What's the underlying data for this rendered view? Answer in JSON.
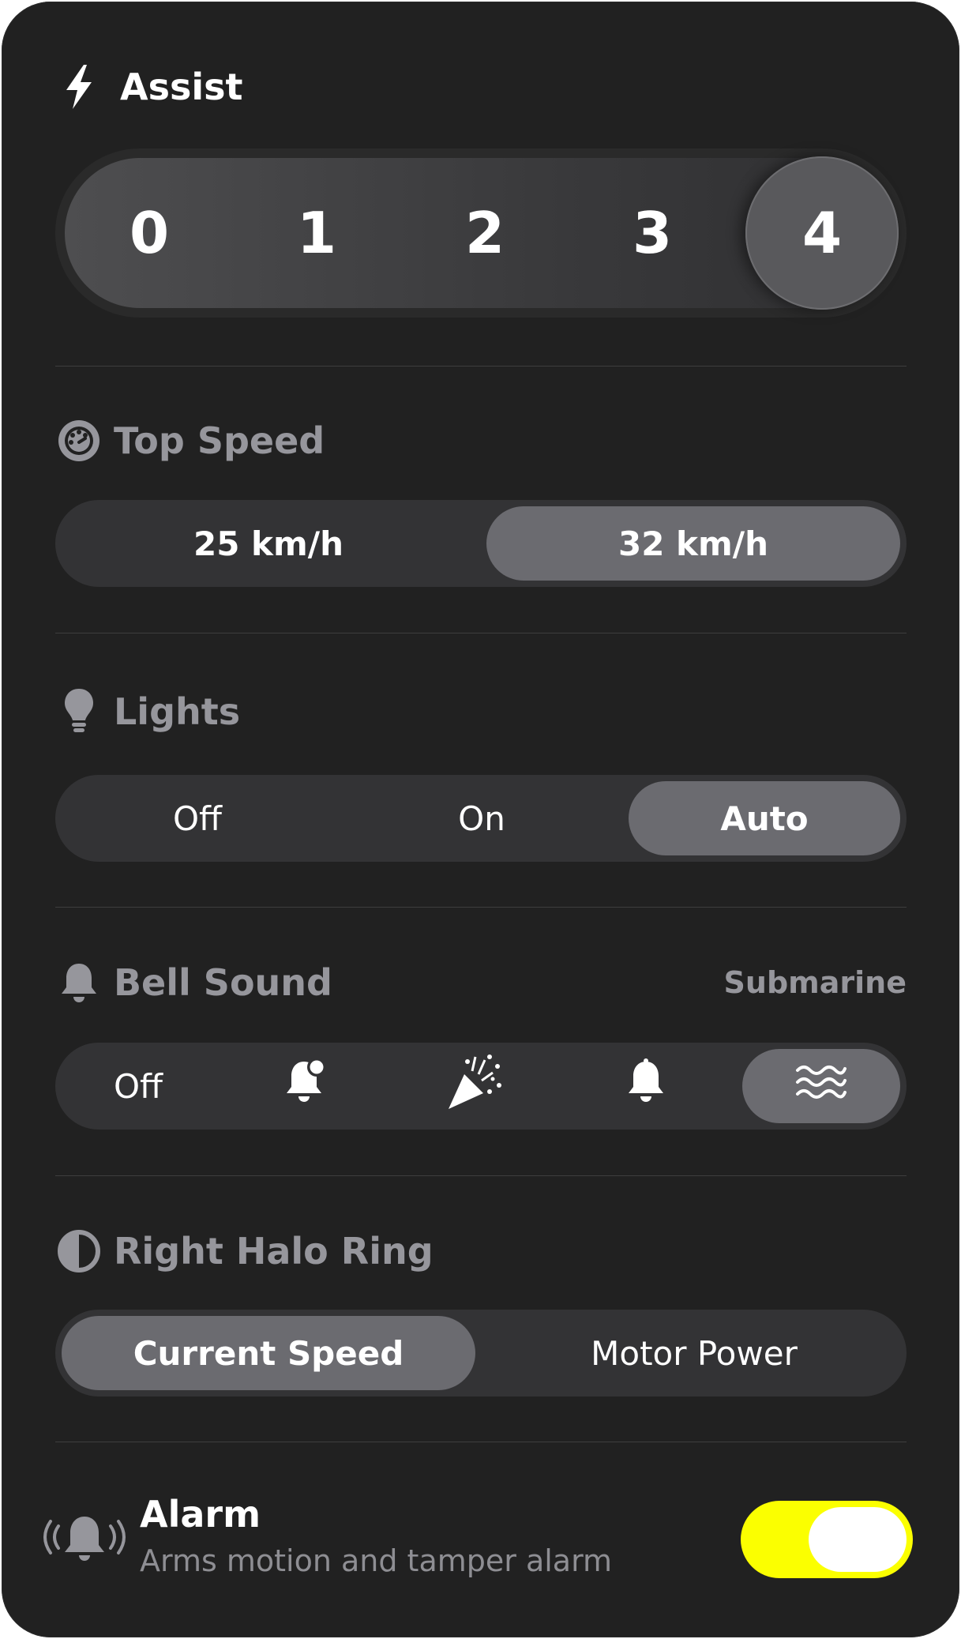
{
  "assist": {
    "title": "Assist",
    "levels": [
      "0",
      "1",
      "2",
      "3",
      "4"
    ],
    "selected": "4"
  },
  "top_speed": {
    "title": "Top Speed",
    "options": [
      "25 km/h",
      "32 km/h"
    ],
    "selected": "32 km/h"
  },
  "lights": {
    "title": "Lights",
    "options": [
      "Off",
      "On",
      "Auto"
    ],
    "selected": "Auto"
  },
  "bell_sound": {
    "title": "Bell Sound",
    "current_value": "Submarine",
    "options": [
      {
        "label": "Off",
        "icon": null
      },
      {
        "label": null,
        "icon": "bell-badge-icon"
      },
      {
        "label": null,
        "icon": "party-popper-icon"
      },
      {
        "label": null,
        "icon": "bell-icon"
      },
      {
        "label": null,
        "icon": "waves-icon"
      }
    ],
    "selected_index": 4
  },
  "halo_ring": {
    "title": "Right Halo Ring",
    "options": [
      "Current Speed",
      "Motor Power"
    ],
    "selected": "Current Speed"
  },
  "alarm": {
    "title": "Alarm",
    "subtitle": "Arms motion and tamper alarm",
    "enabled": true,
    "toggle_color": "#fbff00"
  },
  "colors": {
    "background": "#212121",
    "segment_track": "#333335",
    "segment_selected": "#6b6b70",
    "header_gray": "#96969c",
    "accent": "#fbff00"
  }
}
